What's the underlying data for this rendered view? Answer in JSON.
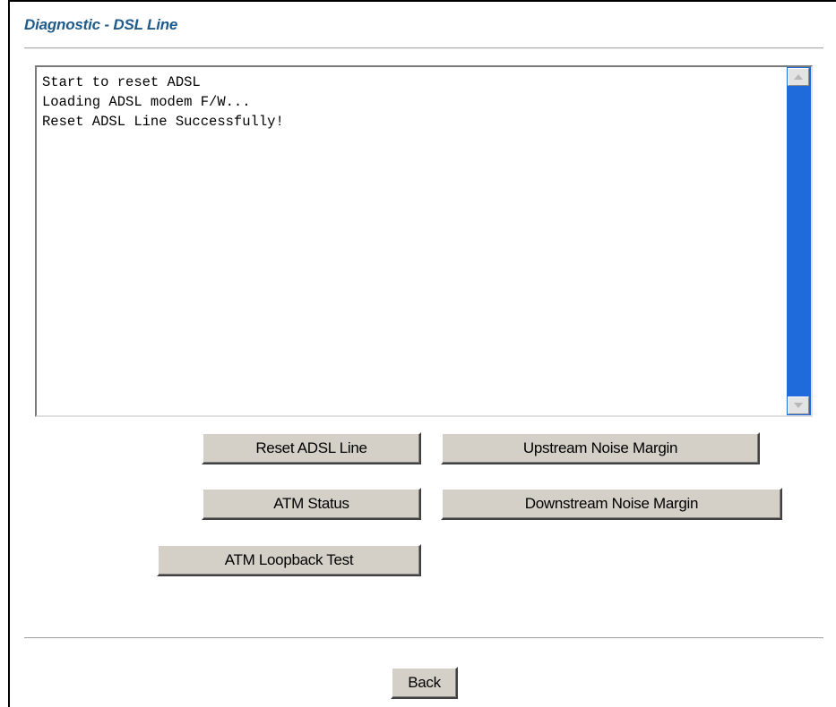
{
  "page": {
    "title": "Diagnostic - DSL Line"
  },
  "log": {
    "lines": [
      "Start to reset ADSL",
      "Loading ADSL modem F/W...",
      "Reset ADSL Line Successfully!"
    ]
  },
  "buttons": {
    "reset_adsl_line": "Reset ADSL Line",
    "upstream_noise_margin": "Upstream Noise Margin",
    "atm_status": "ATM Status",
    "downstream_noise_margin": "Downstream Noise Margin",
    "atm_loopback_test": "ATM Loopback Test",
    "back": "Back"
  },
  "colors": {
    "title": "#1f5b8a",
    "scrollbar_track": "#1f6bdb",
    "button_face": "#d4d0c8"
  },
  "icons": {
    "scroll_up": "scroll-up-arrow-icon",
    "scroll_down": "scroll-down-arrow-icon"
  }
}
